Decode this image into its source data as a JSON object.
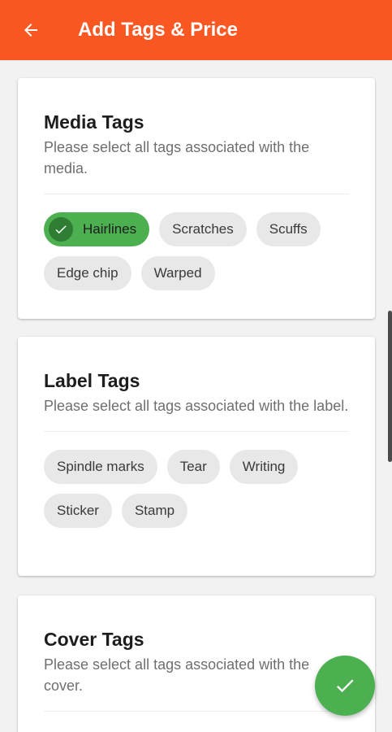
{
  "app_bar": {
    "title": "Add Tags & Price",
    "back_icon": "arrow-left-icon",
    "background": "#fa5722"
  },
  "sections": [
    {
      "title": "Media Tags",
      "description": "Please select all tags associated with the media.",
      "tags": [
        {
          "label": "Hairlines",
          "selected": true
        },
        {
          "label": "Scratches",
          "selected": false
        },
        {
          "label": "Scuffs",
          "selected": false
        },
        {
          "label": "Edge chip",
          "selected": false
        },
        {
          "label": "Warped",
          "selected": false
        }
      ]
    },
    {
      "title": "Label Tags",
      "description": "Please select all tags associated with the label.",
      "tags": [
        {
          "label": "Spindle marks",
          "selected": false
        },
        {
          "label": "Tear",
          "selected": false
        },
        {
          "label": "Writing",
          "selected": false
        },
        {
          "label": "Sticker",
          "selected": false
        },
        {
          "label": "Stamp",
          "selected": false
        }
      ]
    },
    {
      "title": "Cover Tags",
      "description": "Please select all tags associated with the cover."
    }
  ],
  "fab": {
    "icon": "check-icon",
    "color": "#4caf50"
  },
  "colors": {
    "selected_chip": "#4caf50",
    "chip": "#e8e8e8"
  }
}
